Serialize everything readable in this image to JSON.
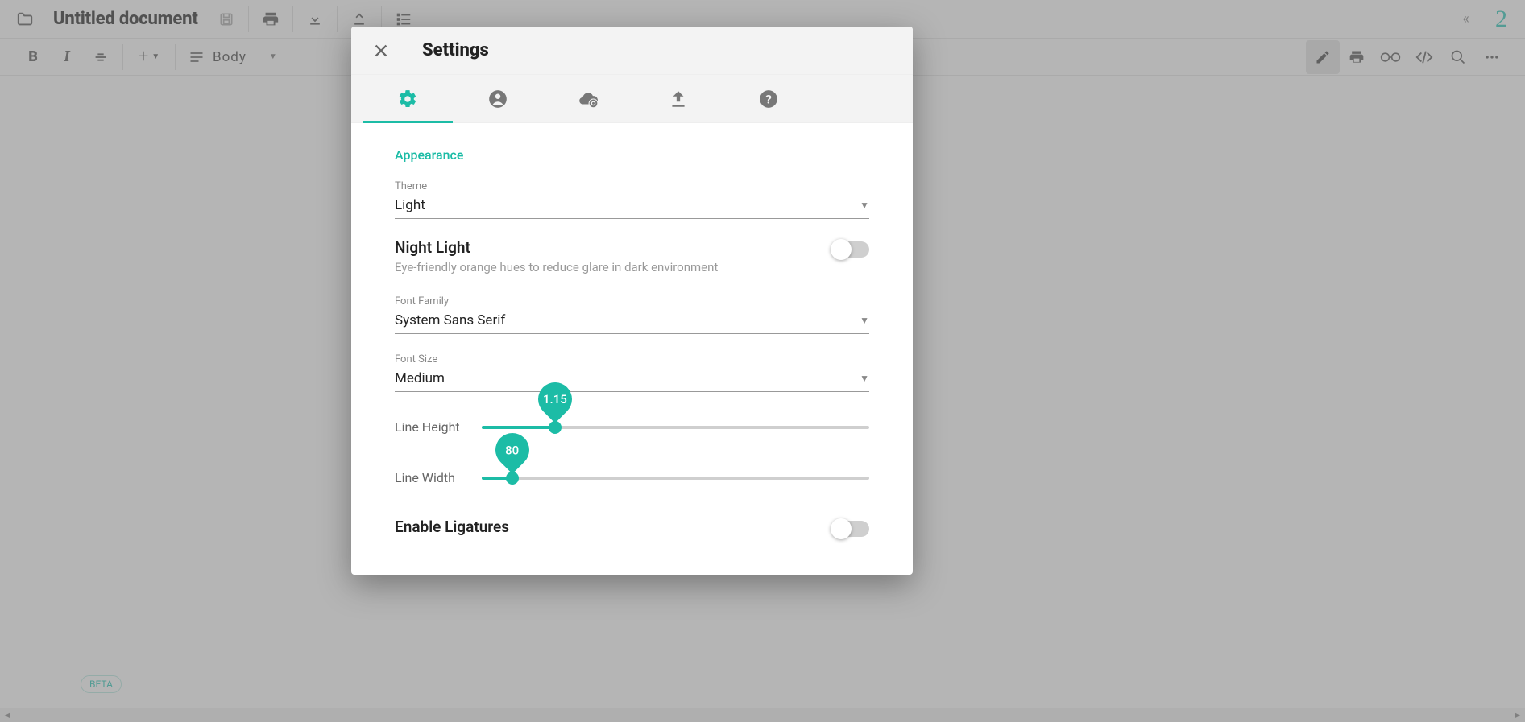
{
  "header": {
    "doc_title": "Untitled document",
    "logo_text": "2"
  },
  "format": {
    "style": "Body"
  },
  "editor": {
    "beta": "BETA"
  },
  "settings": {
    "title": "Settings",
    "section": "Appearance",
    "theme": {
      "label": "Theme",
      "value": "Light"
    },
    "night_light": {
      "title": "Night Light",
      "subtitle": "Eye-friendly orange hues to reduce glare in dark environment",
      "enabled": false
    },
    "font_family": {
      "label": "Font Family",
      "value": "System Sans Serif"
    },
    "font_size": {
      "label": "Font Size",
      "value": "Medium"
    },
    "line_height": {
      "label": "Line Height",
      "value": "1.15"
    },
    "line_width": {
      "label": "Line Width",
      "value": "80"
    },
    "ligatures": {
      "title": "Enable Ligatures",
      "enabled": false
    }
  }
}
